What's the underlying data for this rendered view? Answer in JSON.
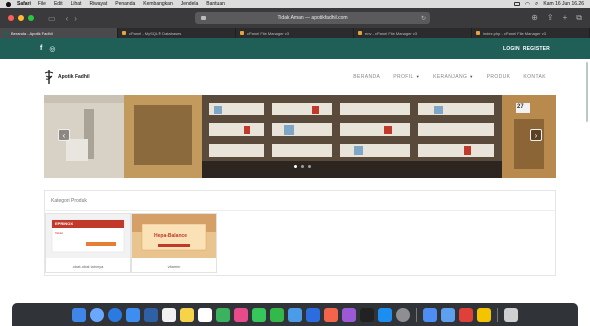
{
  "menubar": {
    "app": "Safari",
    "items": [
      "File",
      "Edit",
      "Lihat",
      "Riwayat",
      "Penanda",
      "Kembangkan",
      "Jendela",
      "Bantuan"
    ],
    "clock": "Kam 16 Jun 16.26"
  },
  "browser": {
    "address": "Tidak Aman — apotikfadhil.com",
    "tabs": [
      {
        "label": "Beranda - Apotik Fadhil",
        "active": true
      },
      {
        "label": "cPanel - MySQL® Databases",
        "active": false
      },
      {
        "label": "cPanel File Manager v3",
        "active": false
      },
      {
        "label": "env - cPanel File Manager v3",
        "active": false
      },
      {
        "label": "index.php - cPanel File Manager v3",
        "active": false
      }
    ]
  },
  "topbar": {
    "social_icons": [
      "facebook-icon",
      "instagram-icon"
    ],
    "login": "LOGIN",
    "register": "REGISTER"
  },
  "header": {
    "brand": "Apotik Fadhil",
    "logo_icon": "pharmacy-caduceus-icon",
    "nav": [
      {
        "label": "BERANDA",
        "dropdown": false
      },
      {
        "label": "PROFIL",
        "dropdown": true
      },
      {
        "label": "KERANJANG",
        "dropdown": true
      },
      {
        "label": "PRODUK",
        "dropdown": false
      },
      {
        "label": "KONTAK",
        "dropdown": false
      }
    ]
  },
  "hero": {
    "prev_icon": "chevron-left-icon",
    "next_icon": "chevron-right-icon",
    "sign_number": "27",
    "slide_count": 3,
    "active_slide": 1
  },
  "categories": {
    "title": "Kategori Produk",
    "items": [
      {
        "caption": "obat-obat lainnya",
        "box_brand": "EPRINOX",
        "box_subtitle": "Tablet"
      },
      {
        "caption": "vitamin",
        "box_brand": "Hepa-Balance",
        "box_subtitle": ""
      }
    ]
  },
  "colors": {
    "topbar": "#1f5f58",
    "nav_text": "#888888",
    "accent_red": "#c0392b"
  }
}
